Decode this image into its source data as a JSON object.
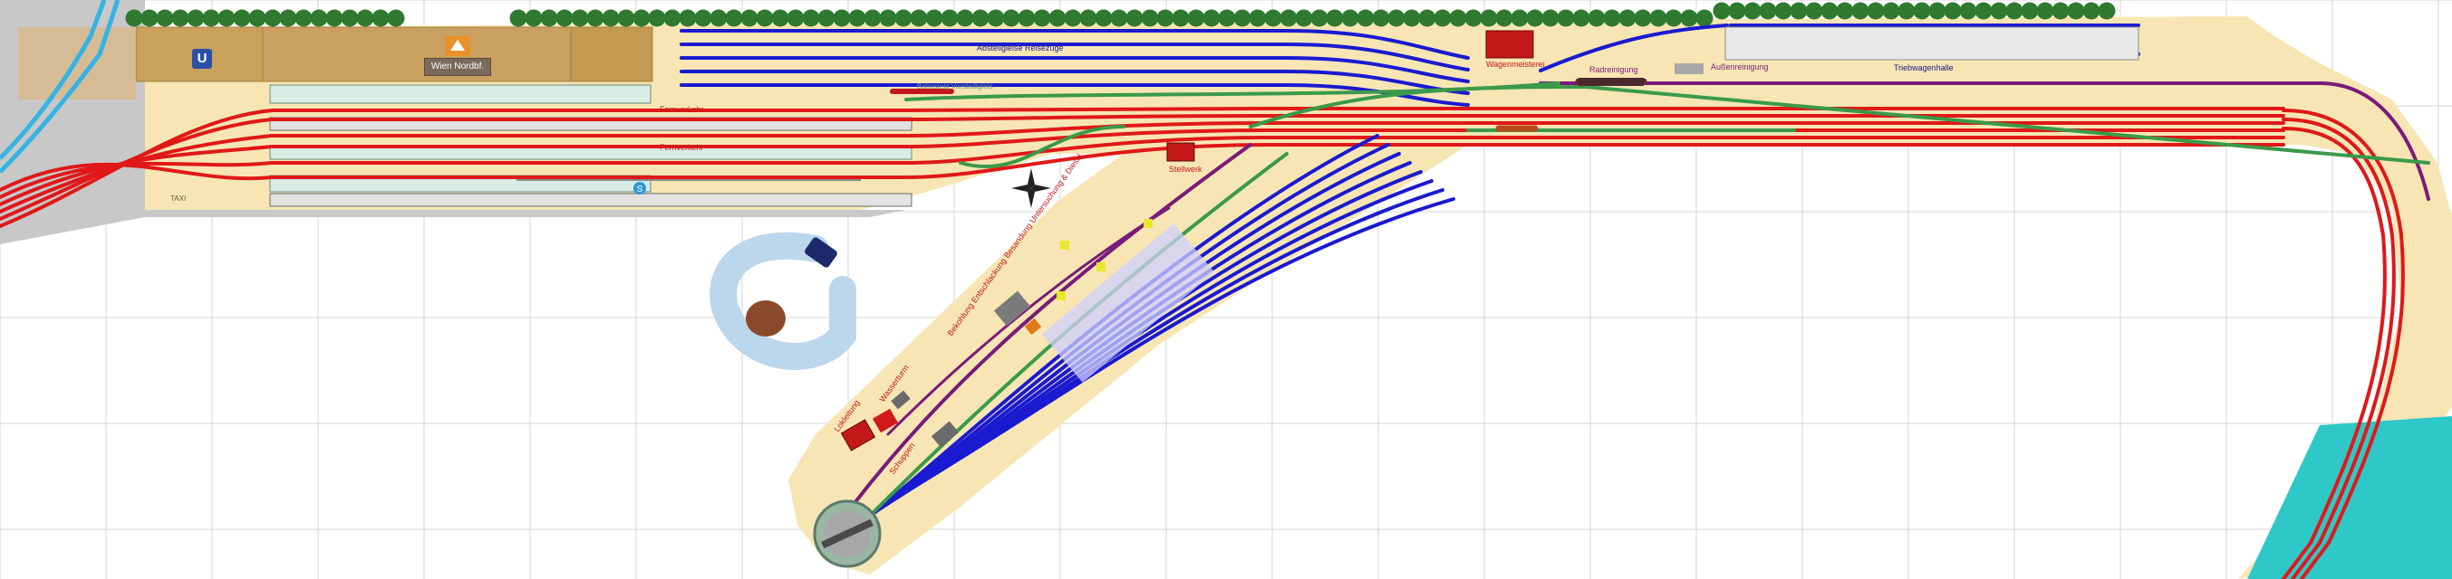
{
  "station": {
    "name": "Wien Nordbf.",
    "ubahn_symbol": "U"
  },
  "labels": {
    "abstellgleise": "Abstellgleise Reisezüge",
    "fernverkehr_top": "Fernverkehr",
    "fernverkehr_mid": "Fernverkehr",
    "wagenmeisterei": "Wagenmeisterei",
    "radreinigung": "Radreinigung",
    "aussenreinigung": "Außenreinigung",
    "triebwagenhalle": "Triebwagenhalle",
    "stellwerk": "Stellwerk",
    "depot_diagonal": "Bekohlung  Entschlackung  Besandung  Untersuchung & Diesel",
    "lokleitung": "Lokleitung",
    "wasserturm": "Wasserturm",
    "schuppen": "Schuppen",
    "ghost_text": "Bahnsteig Vorstadtgleis",
    "taxi": "TAXI",
    "s_symbol": "S"
  },
  "colors": {
    "mainline_track": "#e01818",
    "storage_track": "#1a1ad0",
    "link_track": "#3a9a4a",
    "depot_track": "#7a1a7a",
    "yard_base": "#f7e6b4",
    "station_roof": "#c9a15a",
    "platform": "#d7ece4",
    "road": "#c8c8c8",
    "water": "#2ec8c8",
    "tree": "#2f7a2f",
    "light_blue_loop": "#bcd6ec"
  },
  "icons": [
    "compass-rose-icon",
    "u-bahn-icon",
    "s-bahn-icon",
    "railjet-logo-icon",
    "car-icon",
    "rock-icon"
  ]
}
